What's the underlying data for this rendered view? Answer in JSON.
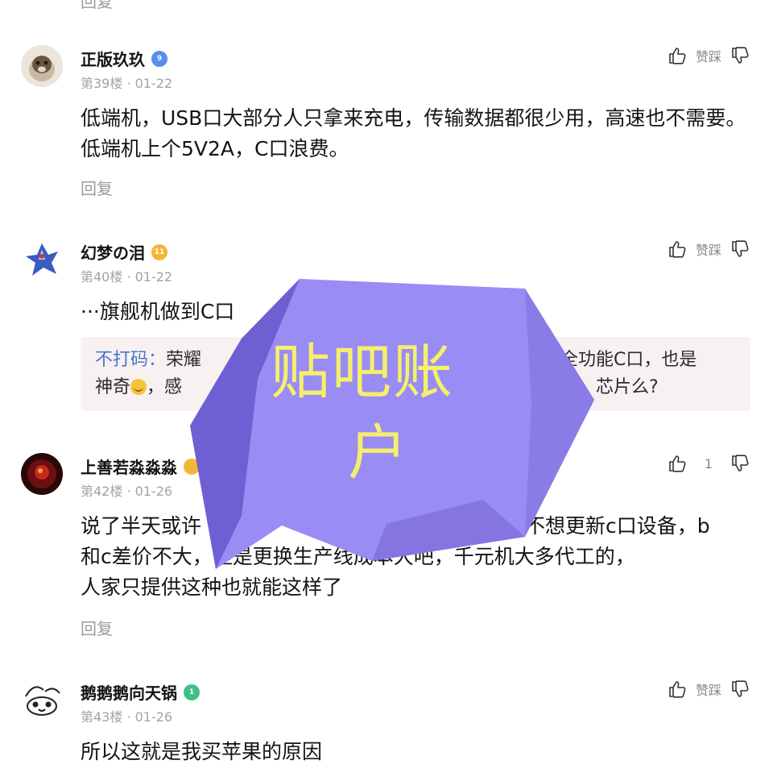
{
  "top_reply_label": "回复",
  "vote": {
    "zan_cai": "赞踩"
  },
  "posts": [
    {
      "username": "正版玖玖",
      "level": "9",
      "level_color": "#5b8df0",
      "meta": "第39楼 · 01-22",
      "content": "低端机，USB口大部分人只拿来充电，传输数据都很少用，高速也不需要。低端机上个5V2A，C口浪费。",
      "reply": "回复"
    },
    {
      "username": "幻梦の泪",
      "level": "11",
      "level_color": "#f2b73a",
      "meta": "第40楼 · 01-22",
      "content": "···旗舰机做到C口",
      "quote": {
        "name": "不打码：",
        "line1": "荣耀",
        "line1_end": "全功能C口，也是",
        "line2_start": "神奇",
        "line2_mid": "，感",
        "line2_end": "芯片么?"
      }
    },
    {
      "username": "上善若淼淼淼",
      "level": "",
      "level_color": "#f2b73a",
      "meta": "第42楼 · 01-26",
      "content_l1_start": "说了半天或许",
      "content_l1_end": "不想更新c口设备，b",
      "content_l2": "和c差价不大，但是更换生产线成本大吧，千元机大多代工的，",
      "content_l3": "人家只提供这种也就能这样了",
      "likes": "1",
      "reply": "回复"
    },
    {
      "username": "鹅鹅鹅向天锅",
      "level": "1",
      "level_color": "#3fbf86",
      "meta": "第43楼 · 01-26",
      "content": "所以这就是我买苹果的原因"
    }
  ],
  "watermark": {
    "line1": "贴吧账",
    "line2": "户",
    "fill_color": "#9a8cf5",
    "text_color": "#f5f06a"
  }
}
